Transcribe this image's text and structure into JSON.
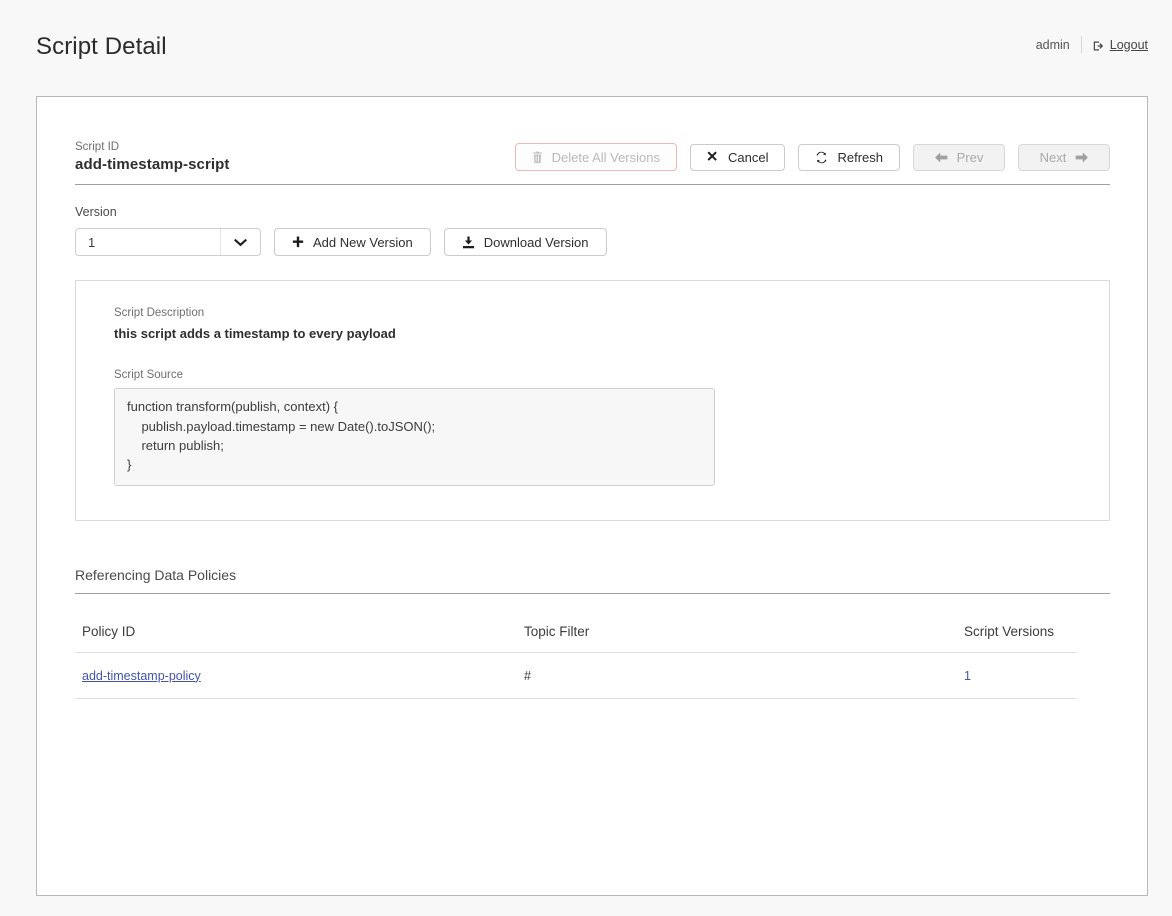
{
  "header": {
    "title": "Script Detail",
    "user": "admin",
    "logout_label": "Logout",
    "logout_icon": "sign-out-icon"
  },
  "script": {
    "id_label": "Script ID",
    "id_value": "add-timestamp-script",
    "version_label": "Version",
    "version_value": "1",
    "version_options": [
      "1"
    ],
    "description_label": "Script Description",
    "description_value": "this script adds a timestamp to every payload",
    "source_label": "Script Source",
    "source_value": "function transform(publish, context) {\n    publish.payload.timestamp = new Date().toJSON();\n    return publish;\n}"
  },
  "toolbar": {
    "delete_all_label": "Delete All Versions",
    "delete_all_icon": "trash-icon",
    "delete_all_disabled": true,
    "cancel_label": "Cancel",
    "cancel_icon": "close-x-icon",
    "refresh_label": "Refresh",
    "refresh_icon": "refresh-icon",
    "prev_label": "Prev",
    "prev_icon": "arrow-left-icon",
    "prev_disabled": true,
    "next_label": "Next",
    "next_icon": "arrow-right-icon",
    "next_disabled": true
  },
  "version_actions": {
    "add_label": "Add New Version",
    "add_icon": "plus-icon",
    "download_label": "Download Version",
    "download_icon": "download-icon"
  },
  "referencing": {
    "title": "Referencing Data Policies",
    "columns": [
      "Policy ID",
      "Topic Filter",
      "Script Versions"
    ],
    "rows": [
      {
        "policy_id": "add-timestamp-policy",
        "topic_filter": "#",
        "script_versions": "1"
      }
    ]
  },
  "colors": {
    "page_bg": "#f8f8f8",
    "card_bg": "#ffffff",
    "card_border": "#b6b8bb",
    "link": "#4554ab",
    "danger_border": "#f4b7b7",
    "disabled_text": "#a9a9a9",
    "code_bg": "#f7f7f7"
  }
}
